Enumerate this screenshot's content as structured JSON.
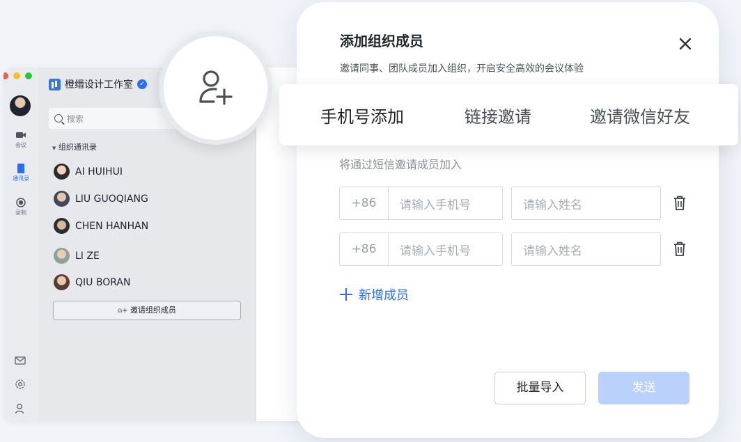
{
  "app": {
    "org_name": "橙缗设计工作室",
    "rail": {
      "meeting": "会议",
      "contacts": "通讯录",
      "record": "录制"
    },
    "search_placeholder": "搜索",
    "section_title": "组织通讯录",
    "members": [
      {
        "name": "AI HUIHUI",
        "avatar_color": "#d7b29a"
      },
      {
        "name": "LIU GUOQIANG",
        "avatar_color": "#3e4a5c"
      },
      {
        "name": "CHEN HANHAN",
        "avatar_color": "#2b2d31"
      },
      {
        "name": "LI ZE",
        "avatar_color": "#8aa39a"
      },
      {
        "name": "QIU BORAN",
        "avatar_color": "#5a3b2e"
      }
    ],
    "invite_button": "邀请组织成员"
  },
  "dialog": {
    "title": "添加组织成员",
    "subtitle": "邀请同事、团队成员加入组织，开启安全高效的会议体验",
    "tabs": [
      {
        "label": "手机号添加",
        "active": true
      },
      {
        "label": "链接邀请",
        "active": false
      },
      {
        "label": "邀请微信好友",
        "active": false
      }
    ],
    "hint": "将通过短信邀请成员加入",
    "rows": [
      {
        "country_code": "+86",
        "phone_placeholder": "请输入手机号",
        "name_placeholder": "请输入姓名"
      },
      {
        "country_code": "+86",
        "phone_placeholder": "请输入手机号",
        "name_placeholder": "请输入姓名"
      }
    ],
    "add_member": "新增成员",
    "batch_import": "批量导入",
    "send": "发送"
  },
  "colors": {
    "accent": "#2a6ff2",
    "send_disabled": "#b9d1fb"
  }
}
